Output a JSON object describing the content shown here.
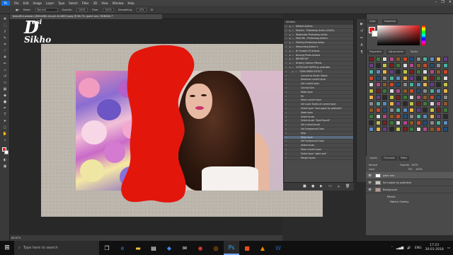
{
  "menubar": {
    "logo": "Ps",
    "items": [
      "File",
      "Edit",
      "Image",
      "Layer",
      "Type",
      "Select",
      "Filter",
      "3D",
      "View",
      "Window",
      "Help"
    ],
    "window_controls": [
      "–",
      "❐",
      "✕"
    ]
  },
  "options": {
    "mode_label": "Mode:",
    "mode_value": "Normal",
    "opacity_label": "Opacity:",
    "opacity_value": "100%",
    "flow_label": "Flow:",
    "flow_value": "100%",
    "smoothing_label": "Smoothing:",
    "smoothing_value": "10%"
  },
  "document": {
    "tab_title": "beautiful-woman-1660x960-lnt-girl-4k-6852.jpeg @ 66.7% (paint one, RGB/8#) *",
    "zoom_status": "66.67%"
  },
  "watermark": {
    "line1": "D",
    "line2": "esi",
    "line3": "Sikho"
  },
  "actions_panel": {
    "title": "Actions",
    "rows": [
      {
        "label": "Default Actions",
        "indent": 0,
        "sel": false
      },
      {
        "label": "Fashion - Photoshop Action (1&#5)",
        "indent": 0,
        "sel": false
      },
      {
        "label": "Watercolor Photoshop Action",
        "indent": 0,
        "sel": false
      },
      {
        "label": "Paint Me - Photoshop Actions",
        "indent": 0,
        "sel": false
      },
      {
        "label": "Painting Photoshop Action",
        "indent": 0,
        "sel": false
      },
      {
        "label": "Retouching Action 4",
        "indent": 0,
        "sel": false
      },
      {
        "label": "Dr Smooth Of Actions",
        "indent": 0,
        "sel": false
      },
      {
        "label": "Burning Photo Actions",
        "indent": 0,
        "sel": false
      },
      {
        "label": "BW BRIGHT",
        "indent": 0,
        "sel": false
      },
      {
        "label": "Dreamy Fashion Effects",
        "indent": 0,
        "sel": false
      },
      {
        "label": "CUTE/GLUE PAPER by psdtutsle",
        "indent": 0,
        "sel": false
      },
      {
        "label": "TORN PAPER EFFECT",
        "indent": 1,
        "sel": false
      },
      {
        "label": "Convert to Smart Object",
        "indent": 2,
        "sel": false
      },
      {
        "label": "Rasterize current layer",
        "indent": 2,
        "sel": false
      },
      {
        "label": "Set current layer",
        "indent": 2,
        "sel": false
      },
      {
        "label": "Canvas Size",
        "indent": 2,
        "sel": false
      },
      {
        "label": "Make layer",
        "indent": 2,
        "sel": false
      },
      {
        "label": "Fill",
        "indent": 2,
        "sel": false
      },
      {
        "label": "Move current layer",
        "indent": 2,
        "sel": false
      },
      {
        "label": "Set Layer Styles of current layer",
        "indent": 2,
        "sel": false
      },
      {
        "label": "Select layer \"torn paper by psdtutsle\"",
        "indent": 2,
        "sel": false
      },
      {
        "label": "Make layer",
        "indent": 2,
        "sel": false
      },
      {
        "label": "Select brush",
        "indent": 2,
        "sel": false
      },
      {
        "label": "Select brush \"Hard Round\"",
        "indent": 2,
        "sel": false
      },
      {
        "label": "Set current brush",
        "indent": 2,
        "sel": false
      },
      {
        "label": "Set Foreground Color",
        "indent": 2,
        "sel": false
      },
      {
        "label": "Stop",
        "indent": 2,
        "sel": false
      },
      {
        "label": "Make layer",
        "indent": 2,
        "sel": true
      },
      {
        "label": "Set Foreground Color",
        "indent": 2,
        "sel": false
      },
      {
        "label": "Select brush",
        "indent": 2,
        "sel": false
      },
      {
        "label": "Move current layer",
        "indent": 2,
        "sel": false
      },
      {
        "label": "Select layer \"paint one\"",
        "indent": 2,
        "sel": false
      },
      {
        "label": "Merge Layers",
        "indent": 2,
        "sel": false
      }
    ]
  },
  "right_panel": {
    "top_tabs": [
      "Color",
      "Swatches"
    ],
    "mid_tabs": [
      "Properties",
      "Adjustments",
      "Styles"
    ],
    "layer_tabs": [
      "Layers",
      "Channels",
      "Paths"
    ],
    "blend_mode": "Normal",
    "opacity_label": "Opacity:",
    "opacity_value": "100%",
    "fill_label": "Fill:",
    "fill_value": "100%",
    "lock_label": "Lock:",
    "layers": [
      {
        "name": "paint one",
        "sel": true
      },
      {
        "name": "torn paper by psdtutsle",
        "sel": false
      },
      {
        "name": "Background",
        "sel": false
      },
      {
        "name": "Effects",
        "sel": false
      },
      {
        "name": "Pattern Overlay",
        "sel": false
      }
    ]
  },
  "colors": {
    "foreground": "#e21b1b",
    "background": "#ffffff",
    "paint": "#e3160c"
  },
  "taskbar": {
    "search_placeholder": "Type here to search",
    "apps": [
      "task-view-icon",
      "edge-icon",
      "explorer-icon",
      "store-icon",
      "dropbox-icon",
      "mail-icon",
      "chrome-icon",
      "firefox-icon",
      "photoshop-icon",
      "app-icon",
      "vlc-icon",
      "word-icon"
    ],
    "lang": "ENG",
    "time": "17:23",
    "date": "30-01-2018"
  }
}
